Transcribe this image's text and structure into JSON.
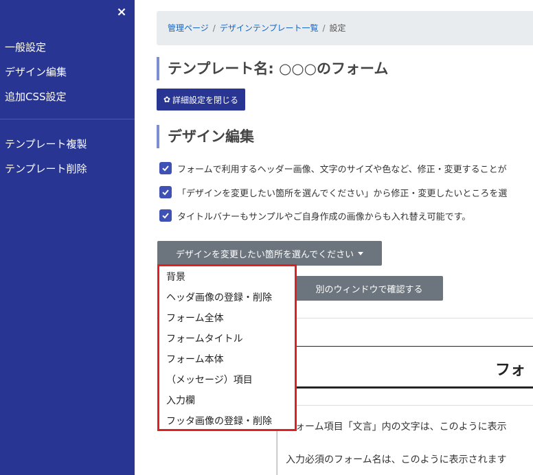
{
  "sidebar": {
    "close_label": "×",
    "items": [
      {
        "label": "一般設定"
      },
      {
        "label": "デザイン編集"
      },
      {
        "label": "追加CSS設定"
      },
      {
        "label": "テンプレート複製"
      },
      {
        "label": "テンプレート削除"
      }
    ]
  },
  "breadcrumb": {
    "items": [
      "管理ページ",
      "デザインテンプレート一覧"
    ],
    "current": "設定",
    "separator": "/"
  },
  "header": {
    "title": "テンプレート名: ○○○のフォーム",
    "toggle_button": "詳細設定を閉じる",
    "toggle_icon": "✿"
  },
  "design": {
    "heading": "デザイン編集",
    "notes": [
      "フォームで利用するヘッダー画像、文字のサイズや色など、修正・変更することが",
      "「デザインを変更したい箇所を選んでください」から修正・変更したいところを選",
      "タイトルバナーもサンプルやご自身作成の画像からも入れ替え可能です。"
    ],
    "dropdown_label": "デザインを変更したい箇所を選んでください",
    "dropdown_options": [
      "背景",
      "ヘッダ画像の登録・削除",
      "フォーム全体",
      "フォームタイトル",
      "フォーム本体",
      "（メッセージ）項目",
      "入力欄",
      "フッタ画像の登録・削除"
    ],
    "open_window_button": "別のウィンドウで確認する"
  },
  "preview": {
    "title_fragment": "フォ",
    "lines": [
      "フォーム項目「文言」内の文字は、このように表示",
      "入力必須のフォーム名は、このように表示されます"
    ]
  },
  "colors": {
    "sidebar_bg": "#283593",
    "primary": "#283593",
    "secondary": "#6c757d",
    "checkbox": "#3f51b5",
    "highlight_border": "#e02020"
  }
}
